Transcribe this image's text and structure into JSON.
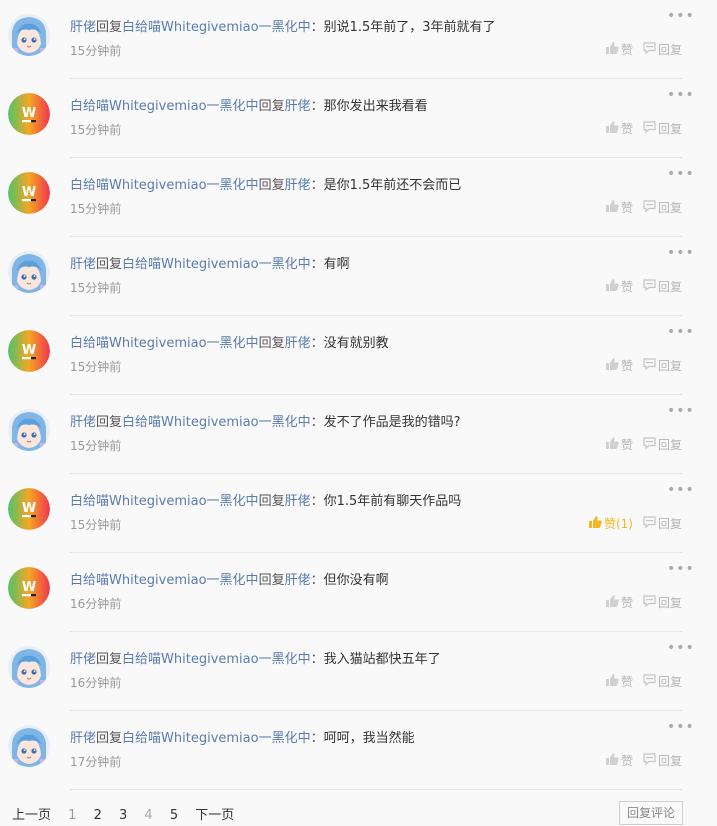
{
  "comments": [
    {
      "user": "肝佬",
      "reply_word": "回复",
      "target": "白给喵Whitegivemiao一黑化中",
      "colon": "：",
      "text": "别说1.5年前了，3年前就有了",
      "time": "15分钟前",
      "avatar": "anime",
      "like_label": "赞",
      "liked": false,
      "reply_label": "回复"
    },
    {
      "user": "白给喵Whitegivemiao一黑化中",
      "reply_word": "回复",
      "target": "肝佬",
      "colon": "：",
      "text": "那你发出来我看看",
      "time": "15分钟前",
      "avatar": "w-logo",
      "like_label": "赞",
      "liked": false,
      "reply_label": "回复"
    },
    {
      "user": "白给喵Whitegivemiao一黑化中",
      "reply_word": "回复",
      "target": "肝佬",
      "colon": "：",
      "text": "是你1.5年前还不会而已",
      "time": "15分钟前",
      "avatar": "w-logo",
      "like_label": "赞",
      "liked": false,
      "reply_label": "回复"
    },
    {
      "user": "肝佬",
      "reply_word": "回复",
      "target": "白给喵Whitegivemiao一黑化中",
      "colon": "：",
      "text": "有啊",
      "time": "15分钟前",
      "avatar": "anime",
      "like_label": "赞",
      "liked": false,
      "reply_label": "回复"
    },
    {
      "user": "白给喵Whitegivemiao一黑化中",
      "reply_word": "回复",
      "target": "肝佬",
      "colon": "：",
      "text": "没有就别教",
      "time": "15分钟前",
      "avatar": "w-logo",
      "like_label": "赞",
      "liked": false,
      "reply_label": "回复"
    },
    {
      "user": "肝佬",
      "reply_word": "回复",
      "target": "白给喵Whitegivemiao一黑化中",
      "colon": "：",
      "text": "发不了作品是我的错吗?",
      "time": "15分钟前",
      "avatar": "anime",
      "like_label": "赞",
      "liked": false,
      "reply_label": "回复"
    },
    {
      "user": "白给喵Whitegivemiao一黑化中",
      "reply_word": "回复",
      "target": "肝佬",
      "colon": "：",
      "text": "你1.5年前有聊天作品吗",
      "time": "15分钟前",
      "avatar": "w-logo",
      "like_label": "赞(1)",
      "liked": true,
      "reply_label": "回复"
    },
    {
      "user": "白给喵Whitegivemiao一黑化中",
      "reply_word": "回复",
      "target": "肝佬",
      "colon": "：",
      "text": "但你没有啊",
      "time": "16分钟前",
      "avatar": "w-logo",
      "like_label": "赞",
      "liked": false,
      "reply_label": "回复"
    },
    {
      "user": "肝佬",
      "reply_word": "回复",
      "target": "白给喵Whitegivemiao一黑化中",
      "colon": "：",
      "text": "我入猫站都快五年了",
      "time": "16分钟前",
      "avatar": "anime",
      "like_label": "赞",
      "liked": false,
      "reply_label": "回复"
    },
    {
      "user": "肝佬",
      "reply_word": "回复",
      "target": "白给喵Whitegivemiao一黑化中",
      "colon": "：",
      "text": "呵呵，我当然能",
      "time": "17分钟前",
      "avatar": "anime",
      "like_label": "赞",
      "liked": false,
      "reply_label": "回复"
    }
  ],
  "pagination": {
    "prev": "上一页",
    "pages": [
      "1",
      "2",
      "3",
      "4",
      "5"
    ],
    "current": "4",
    "next": "下一页"
  },
  "reply_comment_button": "回复评论",
  "colors": {
    "username": "#5a7bb0",
    "liked": "#f5b622",
    "action_gray": "#b5b5b5"
  },
  "more_icon": "ellipsis-icon",
  "like_icon": "thumbs-up-icon",
  "reply_icon": "comment-bubble-icon"
}
